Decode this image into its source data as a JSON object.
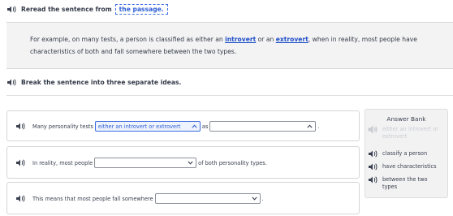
{
  "instructions": {
    "top_prefix": "Reread the sentence from",
    "top_link": "the passage.",
    "second": "Break the sentence into three separate ideas."
  },
  "passage": {
    "part1": "For example, on many tests, a person is classified as either an ",
    "kw1": "introvert",
    "part2": " or an ",
    "kw2": "extrovert",
    "part3": ", when in reality, most people have characteristics of both and fall somewhere between the two types."
  },
  "ideas": [
    {
      "before": "Many personality tests",
      "dropdown1": "either an introvert or extrovert",
      "middle": "as",
      "dropdown2": "",
      "after": "."
    },
    {
      "before": "In reality, most people",
      "dropdown1": "",
      "after": "of both personality types."
    },
    {
      "before": "This means that most people fall somewhere",
      "dropdown1": "",
      "after": "."
    }
  ],
  "answer_bank": {
    "title": "Answer Bank",
    "items": [
      {
        "label": "either an introvert or extrovert",
        "used": true
      },
      {
        "label": "classify a person",
        "used": false
      },
      {
        "label": "have characteristics",
        "used": false
      },
      {
        "label": "between the two types",
        "used": false
      }
    ]
  },
  "icons": {
    "speaker": "speaker-icon",
    "chevron_up": "chevron-up-icon",
    "chevron_down": "chevron-down-icon"
  },
  "colors": {
    "link_blue": "#2f5fd6",
    "keyword_blue": "#1f4fc8",
    "selected_fill": "#eef3fd",
    "passage_bg": "#f3f3f3",
    "bank_bg": "#f2f2f2"
  }
}
